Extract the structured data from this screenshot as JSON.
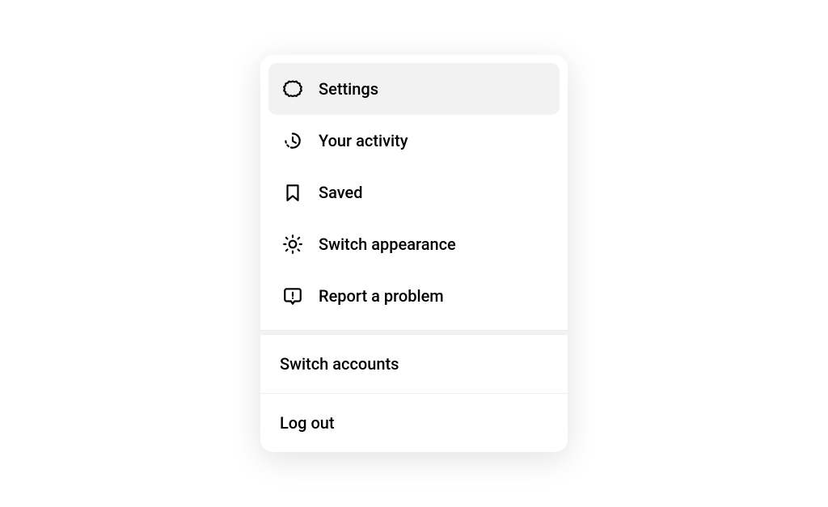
{
  "menu": {
    "primary": [
      {
        "key": "settings",
        "label": "Settings",
        "highlight": true
      },
      {
        "key": "activity",
        "label": "Your activity"
      },
      {
        "key": "saved",
        "label": "Saved"
      },
      {
        "key": "appearance",
        "label": "Switch appearance"
      },
      {
        "key": "report",
        "label": "Report a problem"
      }
    ],
    "secondary": [
      {
        "key": "switch_accounts",
        "label": "Switch accounts"
      },
      {
        "key": "logout",
        "label": "Log out"
      }
    ]
  }
}
